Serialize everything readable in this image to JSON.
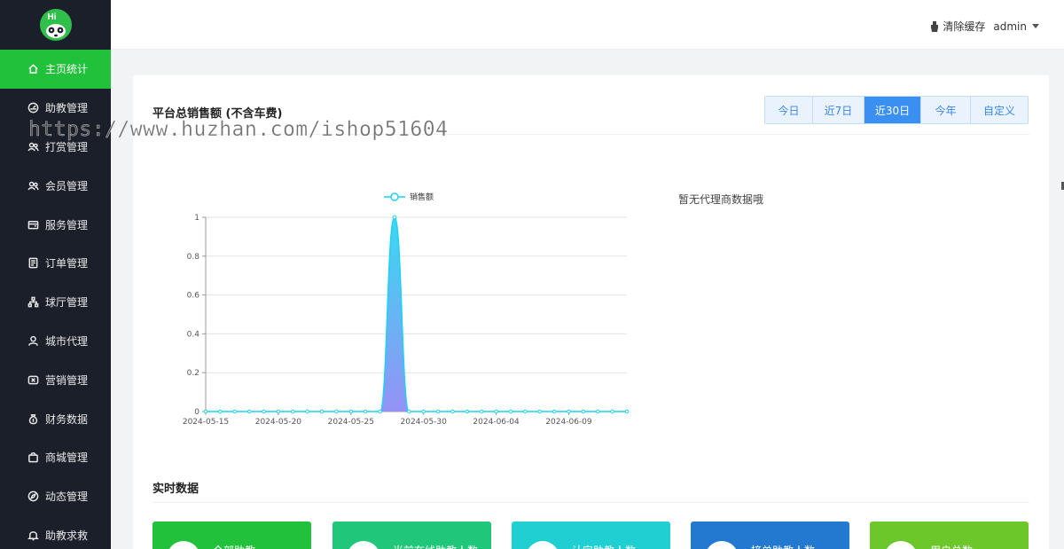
{
  "header": {
    "clear_cache_label": "清除缓存",
    "user_label": "admin"
  },
  "sidebar": {
    "logo_text": "Hi",
    "items": [
      {
        "label": "主页统计",
        "icon": "home-icon",
        "active": true
      },
      {
        "label": "助教管理",
        "icon": "gauge-icon",
        "active": false
      },
      {
        "label": "打赏管理",
        "icon": "users-icon",
        "active": false
      },
      {
        "label": "会员管理",
        "icon": "users-icon",
        "active": false
      },
      {
        "label": "服务管理",
        "icon": "wallet-icon",
        "active": false
      },
      {
        "label": "订单管理",
        "icon": "document-icon",
        "active": false
      },
      {
        "label": "球厅管理",
        "icon": "sitemap-icon",
        "active": false
      },
      {
        "label": "城市代理",
        "icon": "user-icon",
        "active": false
      },
      {
        "label": "营销管理",
        "icon": "ticket-icon",
        "active": false
      },
      {
        "label": "财务数据",
        "icon": "money-bag-icon",
        "active": false
      },
      {
        "label": "商城管理",
        "icon": "shopping-bag-icon",
        "active": false
      },
      {
        "label": "动态管理",
        "icon": "compass-icon",
        "active": false
      },
      {
        "label": "助教求救",
        "icon": "bell-icon",
        "active": false
      }
    ]
  },
  "sales": {
    "title": "平台总销售额 (不含车费)",
    "ranges": [
      {
        "label": "今日",
        "active": false
      },
      {
        "label": "近7日",
        "active": false
      },
      {
        "label": "近30日",
        "active": true
      },
      {
        "label": "今年",
        "active": false
      },
      {
        "label": "自定义",
        "active": false
      }
    ],
    "no_agent_text": "暂无代理商数据哦"
  },
  "realtime": {
    "title": "实时数据",
    "cards": [
      {
        "label": "全部助教",
        "color": "#22c13b"
      },
      {
        "label": "当前在线助教人数",
        "color": "#20c77a"
      },
      {
        "label": "认定助教人数",
        "color": "#1fcfd1"
      },
      {
        "label": "接单助教人数",
        "color": "#2378d0"
      },
      {
        "label": "用户总数",
        "color": "#6cc72a"
      }
    ]
  },
  "watermark": "https://www.huzhan.com/ishop51604",
  "chart_data": {
    "type": "area",
    "legend": [
      "销售额"
    ],
    "series": [
      {
        "name": "销售额",
        "color": "#1fd2f0",
        "fill_top": "#2fd6f2",
        "fill_bottom": "#8f8cf5"
      }
    ],
    "x_start": "2024-05-15",
    "x_end": "2024-06-13",
    "peak_date": "2024-05-28",
    "peak_value": 1,
    "baseline_value": 0,
    "x_tick_labels": [
      "2024-05-15",
      "2024-05-20",
      "2024-05-25",
      "2024-05-30",
      "2024-06-04",
      "2024-06-09"
    ],
    "y_tick_labels": [
      "0",
      "0.2",
      "0.4",
      "0.6",
      "0.8",
      "1"
    ],
    "ylim": [
      0,
      1
    ],
    "grid": true,
    "legend_position": "top-center"
  }
}
